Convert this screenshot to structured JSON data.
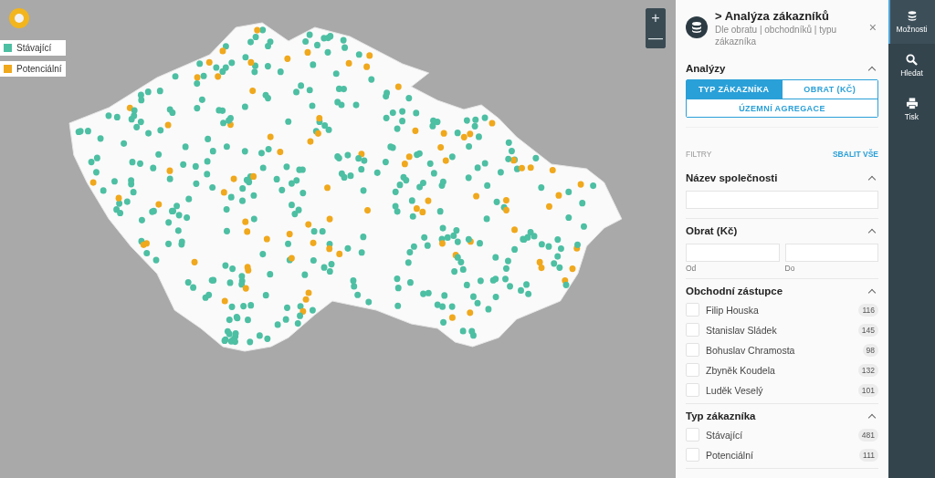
{
  "legend": [
    {
      "label": "Stávající",
      "color": "#4dbfa3"
    },
    {
      "label": "Potenciální",
      "color": "#f0a81c"
    }
  ],
  "zoom_controls": {
    "zoom_in": "+",
    "zoom_out": "—"
  },
  "panel": {
    "title": "> Analýza zákazníků",
    "subtitle": "Dle obratu | obchodníků | typu zákazníka",
    "close": "×",
    "analyses": {
      "title": "Analýzy",
      "expanded": true,
      "tabs": [
        {
          "label": "TYP ZÁKAZNÍKA",
          "selected": true
        },
        {
          "label": "OBRAT (KČ)",
          "selected": false
        },
        {
          "label": "ÚZEMNÍ AGREGACE",
          "selected": false
        }
      ]
    },
    "filters_label": "FILTRY",
    "collapse_all": "SBALIT VŠE",
    "sections": [
      {
        "kind": "text",
        "title": "Název společnosti",
        "expanded": true
      },
      {
        "kind": "range",
        "title": "Obrat (Kč)",
        "expanded": true,
        "from_label": "Od",
        "to_label": "Do"
      },
      {
        "kind": "checklist",
        "title": "Obchodní zástupce",
        "expanded": true,
        "items": [
          {
            "label": "Filip Houska",
            "count": "116",
            "checked": false
          },
          {
            "label": "Stanislav Sládek",
            "count": "145",
            "checked": false
          },
          {
            "label": "Bohuslav Chramosta",
            "count": "98",
            "checked": false
          },
          {
            "label": "Zbyněk Koudela",
            "count": "132",
            "checked": false
          },
          {
            "label": "Luděk Veselý",
            "count": "101",
            "checked": false
          }
        ]
      },
      {
        "kind": "checklist",
        "title": "Typ zákazníka",
        "expanded": true,
        "items": [
          {
            "label": "Stávající",
            "count": "481",
            "checked": false
          },
          {
            "label": "Potenciální",
            "count": "111",
            "checked": false
          }
        ]
      }
    ]
  },
  "sidebar": {
    "items": [
      {
        "label": "Možnosti",
        "kind": "database",
        "selected": true
      },
      {
        "label": "Hledat",
        "kind": "search",
        "selected": false
      },
      {
        "label": "Tisk",
        "kind": "print",
        "selected": false
      }
    ]
  }
}
